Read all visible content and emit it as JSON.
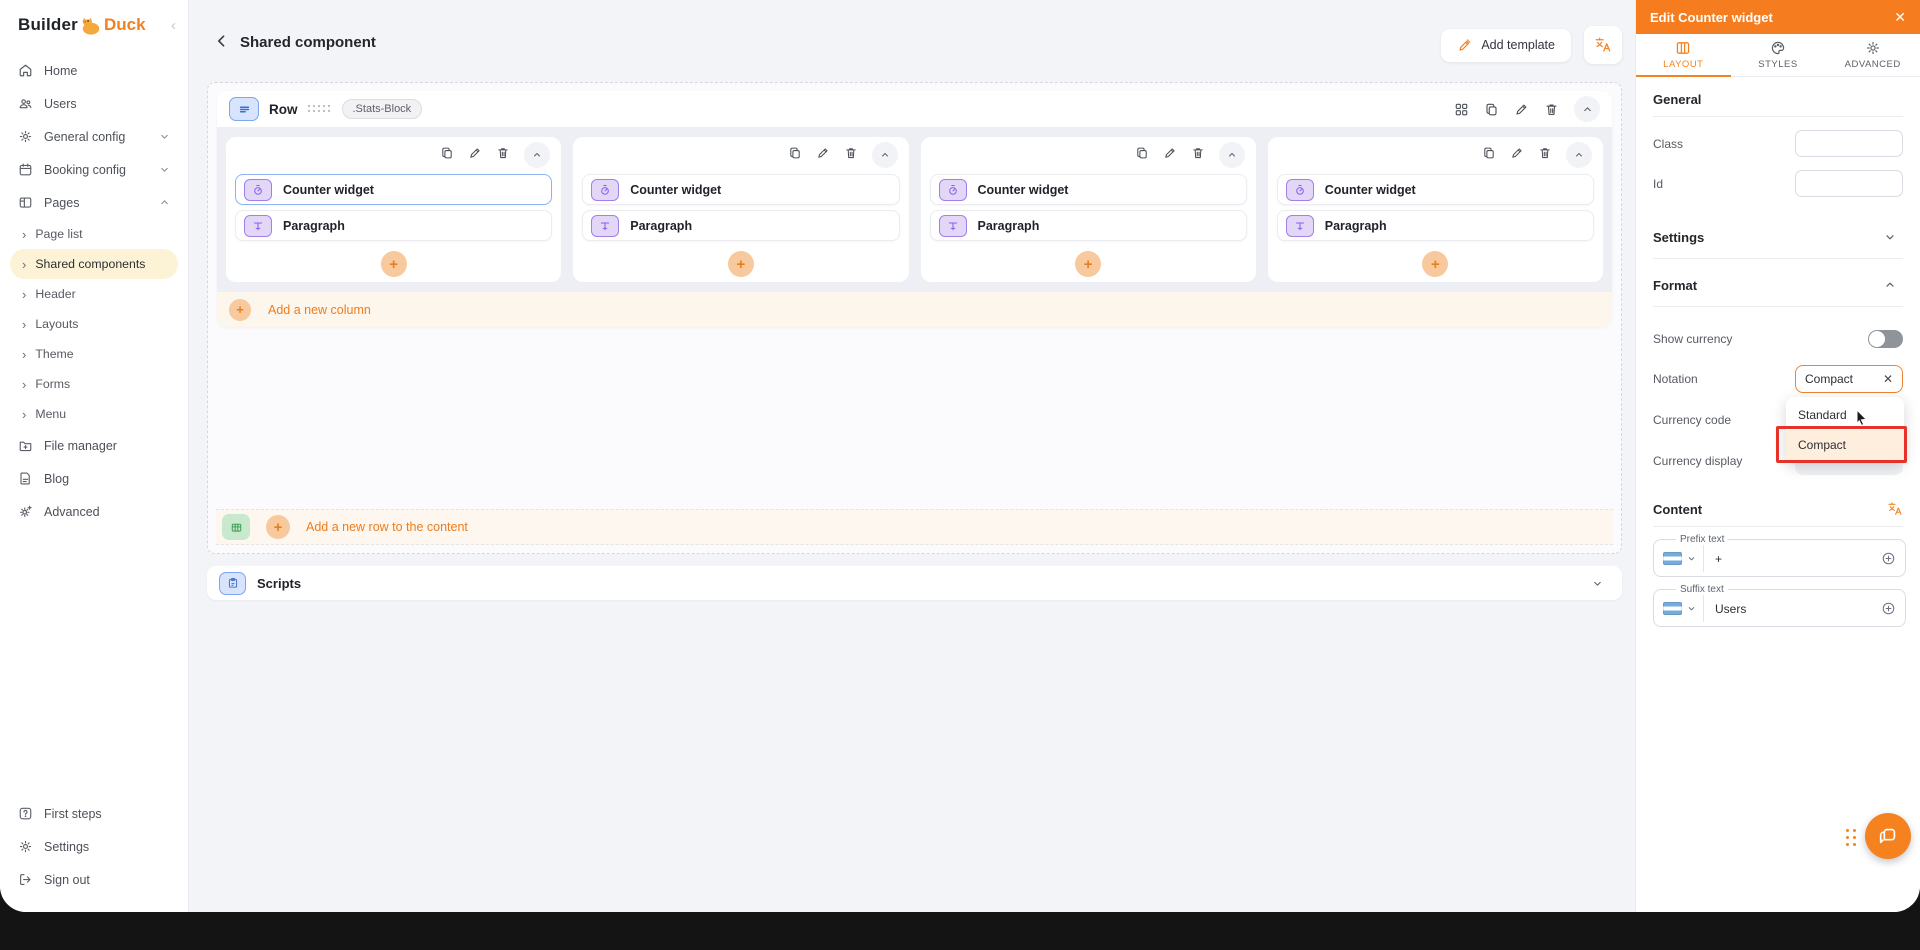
{
  "brand": {
    "builder": "Builder",
    "duck": "Duck"
  },
  "icons": {
    "plus": "+",
    "close": "✕",
    "clear": "✕",
    "chevron_left": "‹",
    "chevron_right": "›"
  },
  "sidebar": {
    "items": [
      {
        "icon": "home-icon",
        "label": "Home"
      },
      {
        "icon": "users-icon",
        "label": "Users"
      },
      {
        "icon": "gear-icon",
        "label": "General config",
        "chevron": "down"
      },
      {
        "icon": "calendar-icon",
        "label": "Booking config",
        "chevron": "down"
      },
      {
        "icon": "pages-icon",
        "label": "Pages",
        "chevron": "up"
      }
    ],
    "sub_items": [
      "Page list",
      "Shared components",
      "Header",
      "Layouts",
      "Theme",
      "Forms",
      "Menu"
    ],
    "active_sub_item": "Shared components",
    "more_items": [
      {
        "icon": "folder-plus-icon",
        "label": "File manager"
      },
      {
        "icon": "document-icon",
        "label": "Blog"
      },
      {
        "icon": "gear-sparkle-icon",
        "label": "Advanced"
      }
    ],
    "footer_items": [
      {
        "icon": "question-icon",
        "label": "First steps"
      },
      {
        "icon": "gear-icon",
        "label": "Settings"
      },
      {
        "icon": "sign-out-icon",
        "label": "Sign out"
      }
    ]
  },
  "header": {
    "title": "Shared component",
    "add_template_label": "Add template"
  },
  "canvas": {
    "row": {
      "label": "Row",
      "class_chip": ".Stats-Block"
    },
    "columns": [
      {
        "items": [
          "Counter widget",
          "Paragraph"
        ]
      },
      {
        "items": [
          "Counter widget",
          "Paragraph"
        ]
      },
      {
        "items": [
          "Counter widget",
          "Paragraph"
        ]
      },
      {
        "items": [
          "Counter widget",
          "Paragraph"
        ]
      }
    ],
    "add_column_label": "Add a new column",
    "add_row_label": "Add a new row to the content",
    "scripts_label": "Scripts"
  },
  "panel": {
    "title": "Edit Counter widget",
    "tabs": [
      {
        "label": "LAYOUT"
      },
      {
        "label": "STYLES"
      },
      {
        "label": "ADVANCED"
      }
    ],
    "active_tab": "LAYOUT",
    "general": {
      "heading": "General",
      "fields": [
        {
          "label": "Class",
          "value": ""
        },
        {
          "label": "Id",
          "value": ""
        }
      ]
    },
    "settings": {
      "heading": "Settings"
    },
    "format": {
      "heading": "Format",
      "show_currency_label": "Show currency",
      "show_currency_on": false,
      "notation_label": "Notation",
      "notation_value": "Compact",
      "notation_options": [
        "Standard",
        "Compact"
      ],
      "highlighted_option": "Compact",
      "currency_code_label": "Currency code",
      "currency_display_label": "Currency display"
    },
    "content": {
      "heading": "Content",
      "prefix_label": "Prefix text",
      "prefix_value": "+",
      "suffix_label": "Suffix text",
      "suffix_value": "Users"
    }
  },
  "colors": {
    "accent_orange": "#f5821f",
    "panel_header": "#f57d1f",
    "annotation_red": "#e63228",
    "selection_blue": "#8fb3f3",
    "widget_purple": "#a27fe9",
    "sidebar_active_bg": "#fcf2d6"
  }
}
